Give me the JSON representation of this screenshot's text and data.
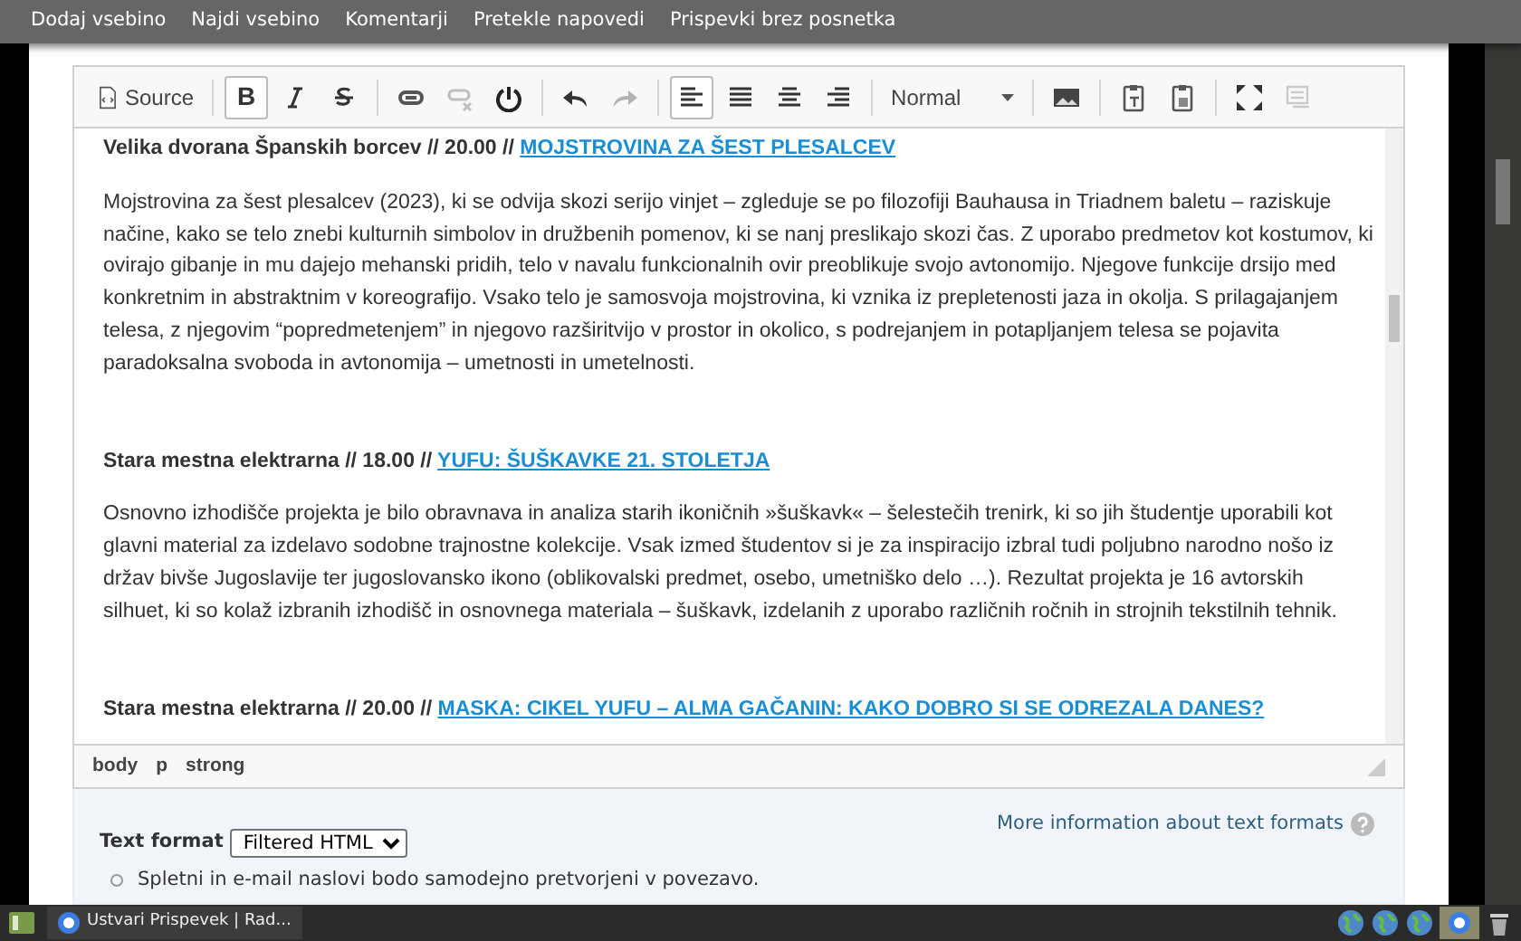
{
  "top_menu": [
    {
      "label": "Dodaj vsebino"
    },
    {
      "label": "Najdi vsebino"
    },
    {
      "label": "Komentarji"
    },
    {
      "label": "Pretekle napovedi"
    },
    {
      "label": "Prispevki brez posnetka"
    }
  ],
  "editor": {
    "toolbar": [
      {
        "kind": "source",
        "label": "Source",
        "on": false,
        "disabled": false
      },
      {
        "kind": "sep"
      },
      {
        "kind": "glyph",
        "label": "B",
        "on": true,
        "disabled": false
      },
      {
        "kind": "icon",
        "on": false,
        "disabled": false
      },
      {
        "kind": "icon",
        "on": false,
        "disabled": false
      },
      {
        "kind": "sep"
      },
      {
        "kind": "icon",
        "on": false,
        "disabled": false
      },
      {
        "kind": "icon",
        "on": false,
        "disabled": true
      },
      {
        "kind": "icon",
        "on": false,
        "disabled": false
      },
      {
        "kind": "sep"
      },
      {
        "kind": "icon",
        "on": false,
        "disabled": false
      },
      {
        "kind": "icon",
        "on": false,
        "disabled": true
      },
      {
        "kind": "sep"
      },
      {
        "kind": "icon",
        "on": true,
        "disabled": false
      },
      {
        "kind": "icon",
        "on": false,
        "disabled": false
      },
      {
        "kind": "icon",
        "on": false,
        "disabled": false
      },
      {
        "kind": "icon",
        "on": false,
        "disabled": false
      },
      {
        "kind": "sep"
      },
      {
        "kind": "combo",
        "label": "Normal"
      },
      {
        "kind": "sep"
      },
      {
        "kind": "icon",
        "on": false,
        "disabled": false
      },
      {
        "kind": "sep"
      },
      {
        "kind": "icon",
        "on": false,
        "disabled": false
      },
      {
        "kind": "icon",
        "on": false,
        "disabled": false
      },
      {
        "kind": "sep"
      },
      {
        "kind": "icon",
        "on": false,
        "disabled": false
      },
      {
        "kind": "icon",
        "on": false,
        "disabled": true
      }
    ],
    "blocks": [
      {
        "kind": "heading",
        "venue": "Velika dvorana Španskih borcev // 20.00 //",
        "link": "MOJSTROVINA ZA ŠEST PLESALCEV"
      },
      {
        "kind": "paragraph",
        "text": "Mojstrovina za šest plesalcev (2023), ki se odvija skozi serijo vinjet – zgleduje se po filozofiji Bauhausa in Triadnem baletu – raziskuje načine, kako se telo znebi kulturnih simbolov in družbenih pomenov, ki se nanj preslikajo skozi čas. Z uporabo predmetov kot kostumov, ki ovirajo gibanje in mu dajejo mehanski pridih, telo v navalu funkcionalnih ovir preoblikuje svojo avtonomijo. Njegove funkcije drsijo med konkretnim in abstraktnim v koreografijo. Vsako telo je samosvoja mojstrovina, ki vznika iz prepletenosti jaza in okolja. S prilagajanjem telesa, z njegovim “popredmetenjem” in njegovo razširitvijo v prostor in okolico, s podrejanjem in potapljanjem telesa se pojavita paradoksalna svoboda in avtonomija – umetnosti in umetelnosti."
      },
      {
        "kind": "spacer"
      },
      {
        "kind": "heading",
        "venue": "Stara mestna elektrarna // 18.00 //",
        "link": "YUFU: ŠUŠKAVKE 21. STOLETJA"
      },
      {
        "kind": "paragraph",
        "text": "Osnovno izhodišče projekta je bilo obravnava in analiza starih ikoničnih »šuškavk« – šelestečih trenirk, ki so jih študentje uporabili kot glavni material za izdelavo sodobne trajnostne kolekcije. Vsak izmed študentov si je za inspiracijo izbral tudi poljubno narodno nošo iz držav bivše Jugoslavije ter jugoslovansko ikono (oblikovalski predmet, osebo, umetniško delo …). Rezultat projekta je 16 avtorskih silhuet, ki so kolaž izbranih izhodišč in osnovnega materiala – šuškavk, izdelanih z uporabo različnih ročnih in strojnih tekstilnih tehnik."
      },
      {
        "kind": "spacer"
      },
      {
        "kind": "heading",
        "venue": "Stara mestna elektrarna // 20.00 //",
        "link": "MASKA: CIKEL YUFU – ALMA GAČANIN: KAKO DOBRO SI SE ODREZALA DANES?"
      }
    ],
    "path": [
      "body",
      "p",
      "strong"
    ]
  },
  "text_format": {
    "label": "Text format",
    "value": "Filtered HTML",
    "help_link": "More information about text formats",
    "tips": [
      "Spletni in e-mail naslovi bodo samodejno pretvorjeni v povezavo."
    ]
  },
  "taskbar": {
    "window_title": "Ustvari Prispevek | Rad..."
  }
}
